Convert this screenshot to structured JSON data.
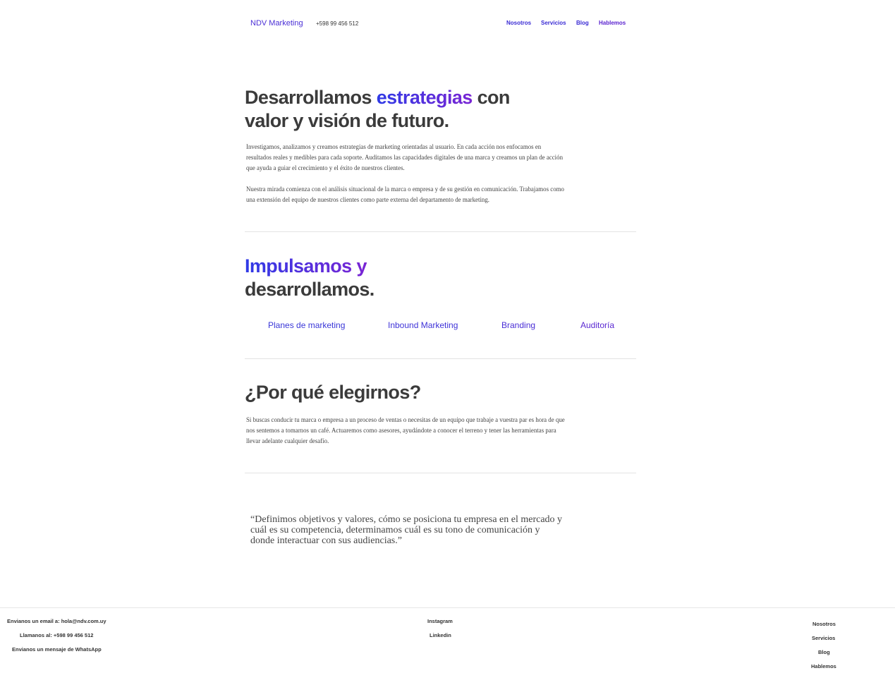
{
  "header": {
    "brand": "NDV Marketing",
    "phone": "+598 99 456 512",
    "nav": [
      "Nosotros",
      "Servicios",
      "Blog",
      "Hablemos"
    ]
  },
  "hero": {
    "title_part1": "Desarrollamos ",
    "title_highlight": "estrategias",
    "title_part2": " con valor y visión de futuro.",
    "paragraph1": "Investigamos, analizamos y creamos estrategias de marketing orientadas al usuario. En cada acción nos enfocamos en resultados reales y medibles para cada soporte. Auditamos las capacidades digitales de una marca y creamos un plan de acción que ayuda a guiar el crecimiento y el éxito de nuestros clientes.",
    "paragraph2": "Nuestra mirada comienza con el análisis situacional de la marca o empresa y de su gestión en comunicación. Trabajamos como una extensión del equipo de nuestros clientes como parte externa del departamento de marketing."
  },
  "services": {
    "title_highlight": "Impulsamos y",
    "title_rest": "desarrollamos.",
    "items": [
      "Planes de marketing",
      "Inbound Marketing",
      "Branding",
      "Auditoría"
    ]
  },
  "why": {
    "title": "¿Por qué elegirnos?",
    "paragraph": "Si buscas conducir tu marca o empresa a un proceso de ventas o necesitas de un equipo que trabaje a vuestra par es hora de que nos sentemos a tomarnos un café. Actuaremos como asesores, ayudándote a conocer el terreno y tener las herramientas para llevar adelante cualquier desafío."
  },
  "quote": "“Definimos objetivos y valores, cómo se posiciona tu empresa en el mercado y cuál es su competencia, determinamos cuál es su tono de comunicación y donde interactuar con sus audiencias.”",
  "footer": {
    "contact": [
      "Envianos un email a: hola@ndv.com.uy",
      "Llamanos al: +598 99 456 512",
      "Envianos un mensaje de WhatsApp"
    ],
    "social": [
      "Instagram",
      "Linkedin"
    ],
    "nav": [
      "Nosotros",
      "Servicios",
      "Blog",
      "Hablemos"
    ]
  },
  "colors": {
    "accent_start": "#2f3ae6",
    "accent_end": "#7a25d4",
    "text": "#3b3b3b"
  }
}
